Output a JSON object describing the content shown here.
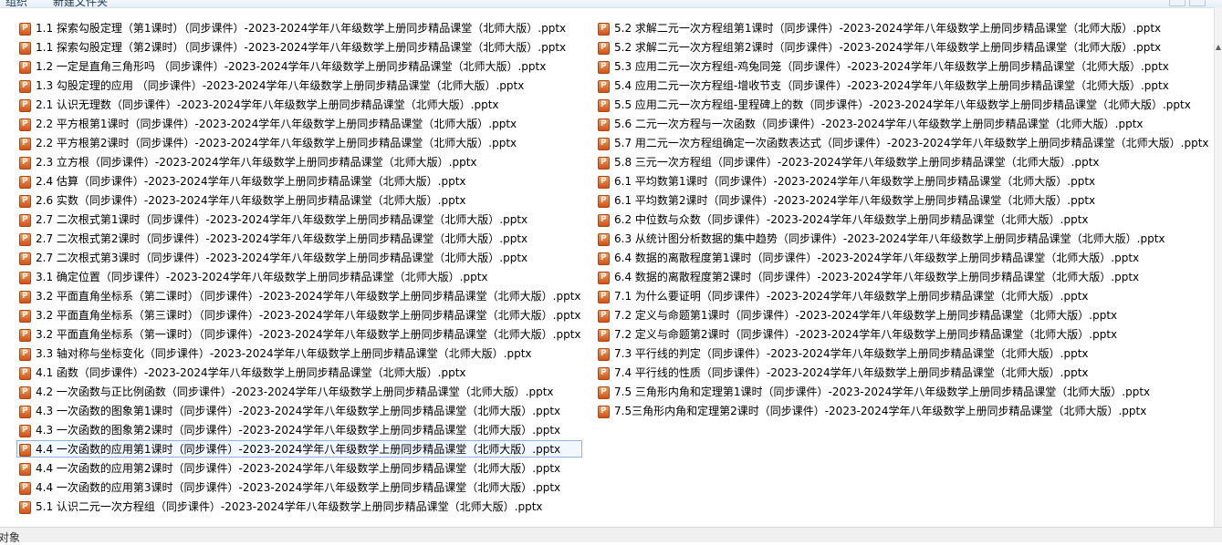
{
  "toolbar": {
    "item1": "组织",
    "item2": "新建文件夹"
  },
  "status": {
    "text": "对象"
  },
  "files_left": [
    "1.1 探索勾股定理（第1课时）（同步课件）-2023-2024学年八年级数学上册同步精品课堂（北师大版）.pptx",
    "1.1 探索勾股定理（第2课时）（同步课件）-2023-2024学年八年级数学上册同步精品课堂（北师大版）.pptx",
    "1.2 一定是直角三角形吗 （同步课件）-2023-2024学年八年级数学上册同步精品课堂（北师大版）.pptx",
    "1.3 勾股定理的应用 （同步课件）-2023-2024学年八年级数学上册同步精品课堂（北师大版）.pptx",
    "2.1 认识无理数（同步课件）-2023-2024学年八年级数学上册同步精品课堂（北师大版）.pptx",
    "2.2 平方根第1课时（同步课件）-2023-2024学年八年级数学上册同步精品课堂（北师大版）.pptx",
    "2.2 平方根第2课时（同步课件）-2023-2024学年八年级数学上册同步精品课堂（北师大版）.pptx",
    "2.3 立方根（同步课件）-2023-2024学年八年级数学上册同步精品课堂（北师大版）.pptx",
    "2.4 估算（同步课件）-2023-2024学年八年级数学上册同步精品课堂（北师大版）.pptx",
    "2.6 实数（同步课件）-2023-2024学年八年级数学上册同步精品课堂（北师大版）.pptx",
    "2.7 二次根式第1课时（同步课件）-2023-2024学年八年级数学上册同步精品课堂（北师大版）.pptx",
    "2.7 二次根式第2课时（同步课件）-2023-2024学年八年级数学上册同步精品课堂（北师大版）.pptx",
    "2.7 二次根式第3课时（同步课件）-2023-2024学年八年级数学上册同步精品课堂（北师大版）.pptx",
    "3.1 确定位置（同步课件）-2023-2024学年八年级数学上册同步精品课堂（北师大版）.pptx",
    "3.2 平面直角坐标系（第二课时）（同步课件）-2023-2024学年八年级数学上册同步精品课堂（北师大版）.pptx",
    "3.2 平面直角坐标系（第三课时）（同步课件）-2023-2024学年八年级数学上册同步精品课堂（北师大版）.pptx",
    "3.2 平面直角坐标系（第一课时）（同步课件）-2023-2024学年八年级数学上册同步精品课堂（北师大版）.pptx",
    "3.3 轴对称与坐标变化（同步课件）-2023-2024学年八年级数学上册同步精品课堂（北师大版）.pptx",
    "4.1 函数（同步课件）-2023-2024学年八年级数学上册同步精品课堂（北师大版）.pptx",
    "4.2 一次函数与正比例函数（同步课件）-2023-2024学年八年级数学上册同步精品课堂（北师大版）.pptx",
    "4.3 一次函数的图象第1课时（同步课件）-2023-2024学年八年级数学上册同步精品课堂（北师大版）.pptx",
    "4.3 一次函数的图象第2课时（同步课件）-2023-2024学年八年级数学上册同步精品课堂（北师大版）.pptx",
    "4.4 一次函数的应用第1课时（同步课件）-2023-2024学年八年级数学上册同步精品课堂（北师大版）.pptx",
    "4.4 一次函数的应用第2课时（同步课件）-2023-2024学年八年级数学上册同步精品课堂（北师大版）.pptx",
    "4.4 一次函数的应用第3课时（同步课件）-2023-2024学年八年级数学上册同步精品课堂（北师大版）.pptx",
    "5.1 认识二元一次方程组（同步课件）-2023-2024学年八年级数学上册同步精品课堂（北师大版）.pptx"
  ],
  "files_right": [
    "5.2 求解二元一次方程组第1课时（同步课件）-2023-2024学年八年级数学上册同步精品课堂（北师大版）.pptx",
    "5.2 求解二元一次方程组第2课时（同步课件）-2023-2024学年八年级数学上册同步精品课堂（北师大版）.pptx",
    "5.3 应用二元一次方程组-鸡兔同笼（同步课件）-2023-2024学年八年级数学上册同步精品课堂（北师大版）.pptx",
    "5.4 应用二元一次方程组-增收节支（同步课件）-2023-2024学年八年级数学上册同步精品课堂（北师大版）.pptx",
    "5.5 应用二元一次方程组-里程碑上的数（同步课件）-2023-2024学年八年级数学上册同步精品课堂（北师大版）.pptx",
    "5.6 二元一次方程与一次函数（同步课件）-2023-2024学年八年级数学上册同步精品课堂（北师大版）.pptx",
    "5.7 用二元一次方程组确定一次函数表达式（同步课件）-2023-2024学年八年级数学上册同步精品课堂（北师大版）.pptx",
    "5.8 三元一次方程组（同步课件）-2023-2024学年八年级数学上册同步精品课堂（北师大版）.pptx",
    "6.1 平均数第1课时（同步课件）-2023-2024学年八年级数学上册同步精品课堂（北师大版）.pptx",
    "6.1 平均数第2课时（同步课件）-2023-2024学年八年级数学上册同步精品课堂（北师大版）.pptx",
    "6.2 中位数与众数（同步课件）-2023-2024学年八年级数学上册同步精品课堂（北师大版）.pptx",
    "6.3 从统计图分析数据的集中趋势（同步课件）-2023-2024学年八年级数学上册同步精品课堂（北师大版）.pptx",
    "6.4 数据的离散程度第1课时（同步课件）-2023-2024学年八年级数学上册同步精品课堂（北师大版）.pptx",
    "6.4 数据的离散程度第2课时（同步课件）-2023-2024学年八年级数学上册同步精品课堂（北师大版）.pptx",
    "7.1 为什么要证明（同步课件）-2023-2024学年八年级数学上册同步精品课堂（北师大版）.pptx",
    "7.2 定义与命题第1课时（同步课件）-2023-2024学年八年级数学上册同步精品课堂（北师大版）.pptx",
    "7.2 定义与命题第2课时（同步课件）-2023-2024学年八年级数学上册同步精品课堂（北师大版）.pptx",
    "7.3 平行线的判定（同步课件）-2023-2024学年八年级数学上册同步精品课堂（北师大版）.pptx",
    "7.4 平行线的性质（同步课件）-2023-2024学年八年级数学上册同步精品课堂（北师大版）.pptx",
    "7.5 三角形内角和定理第1课时（同步课件）-2023-2024学年八年级数学上册同步精品课堂（北师大版）.pptx",
    "7.5三角形内角和定理第2课时（同步课件）-2023-2024学年八年级数学上册同步精品课堂（北师大版）.pptx"
  ],
  "focused_left_index": 22
}
